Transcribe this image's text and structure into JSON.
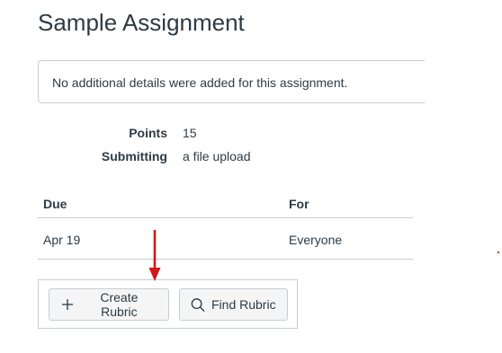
{
  "page": {
    "title": "Sample Assignment"
  },
  "details": {
    "text": "No additional details were added for this assignment."
  },
  "info": {
    "points_label": "Points",
    "points_value": "15",
    "submitting_label": "Submitting",
    "submitting_value": "a file upload"
  },
  "due_table": {
    "headers": [
      "Due",
      "For"
    ],
    "rows": [
      [
        "Apr 19",
        "Everyone"
      ]
    ]
  },
  "rubric": {
    "create_label": "Create Rubric",
    "find_label": "Find Rubric",
    "create_icon": "plus-icon",
    "find_icon": "search-icon"
  },
  "annotation": {
    "arrow_color": "#d01818"
  },
  "colors": {
    "text": "#2d3b45",
    "border": "#c7cdd1",
    "button_bg": "#f5f5f5"
  }
}
